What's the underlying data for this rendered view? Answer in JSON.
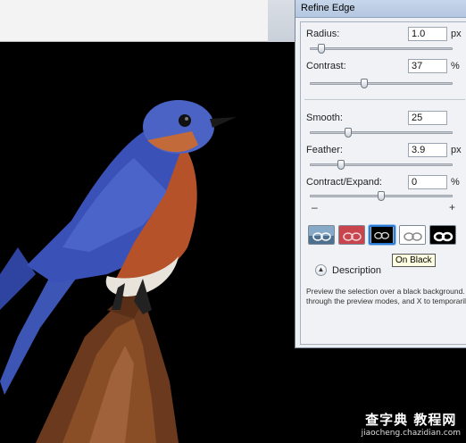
{
  "dialog": {
    "title": "Refine Edge",
    "radius": {
      "label": "Radius:",
      "value": "1.0",
      "unit": "px",
      "slider_level": 0.05
    },
    "contrast": {
      "label": "Contrast:",
      "value": "37",
      "unit": "%",
      "slider_level": 0.37
    },
    "smooth": {
      "label": "Smooth:",
      "value": "25",
      "slider_level": 0.25
    },
    "feather": {
      "label": "Feather:",
      "value": "3.9",
      "unit": "px",
      "slider_level": 0.2
    },
    "contract": {
      "label": "Contract/Expand:",
      "value": "0",
      "unit": "%",
      "slider_level": 0.5
    },
    "minus_label": "–",
    "plus_label": "+",
    "view_modes": [
      {
        "icon": "standard-preview-icon"
      },
      {
        "icon": "quick-mask-preview-icon"
      },
      {
        "icon": "on-black-preview-icon",
        "selected": true
      },
      {
        "icon": "on-white-preview-icon"
      },
      {
        "icon": "mask-preview-icon"
      }
    ],
    "tooltip": "On Black",
    "description": {
      "label": "Description",
      "text_line1": "Preview the selection over a black background. Pre",
      "text_line2": "through the preview modes, and X to temporarily v"
    }
  },
  "watermark": {
    "main": "查字典 教程网",
    "sub": "jiaocheng.chazidian.com"
  }
}
